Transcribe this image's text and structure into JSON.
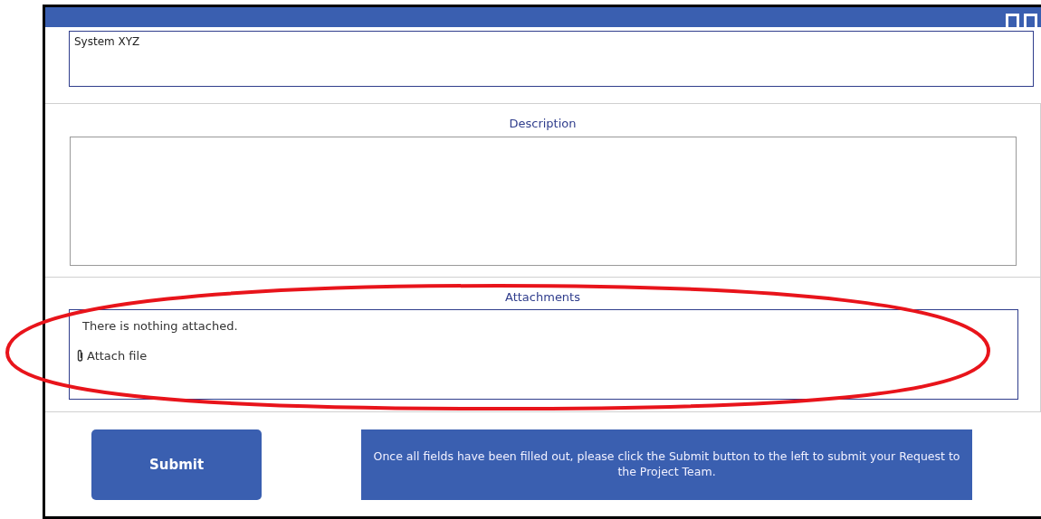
{
  "system_field": {
    "value": "System XYZ"
  },
  "description": {
    "label": "Description"
  },
  "attachments": {
    "label": "Attachments",
    "message": "There is nothing attached.",
    "attach_link": "Attach file"
  },
  "submit_button": "Submit",
  "info_banner": "Once all fields have been filled out, please click the Submit button to the left to submit your Request to the Project Team."
}
